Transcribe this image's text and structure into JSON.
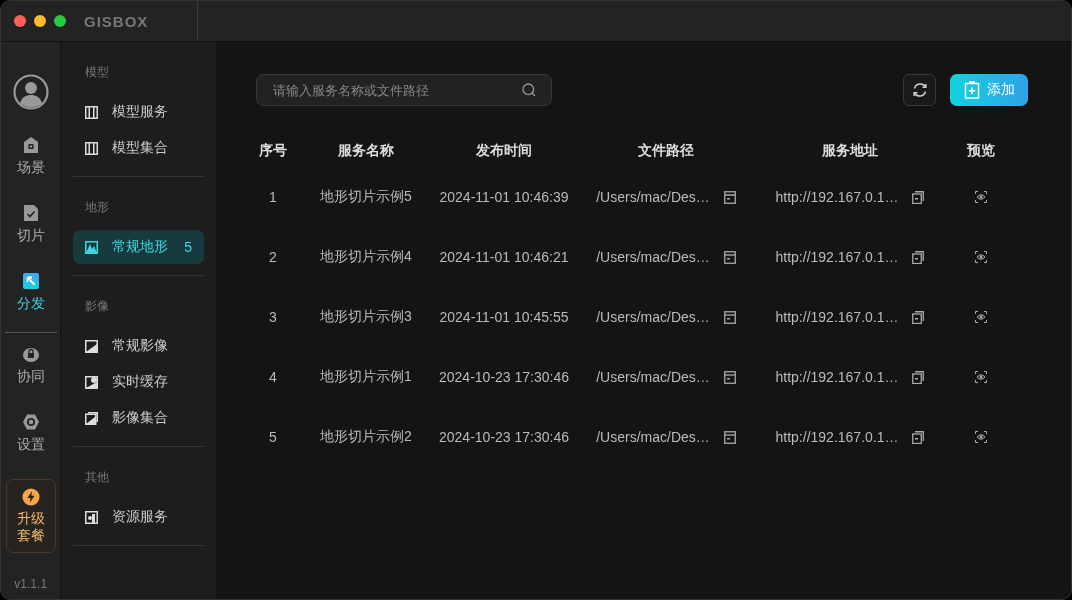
{
  "window": {
    "logo": "GISBOX"
  },
  "rail": {
    "items": [
      {
        "kind": "scene",
        "label": "场景",
        "selected": false
      },
      {
        "kind": "tile",
        "label": "切片",
        "selected": false
      },
      {
        "kind": "publish",
        "label": "分发",
        "selected": true
      },
      {
        "kind": "collab",
        "label": "协同",
        "selected": false
      },
      {
        "kind": "settings",
        "label": "设置",
        "selected": false
      }
    ],
    "upgrade": {
      "label": "升级套餐"
    },
    "version": "v1.1.1"
  },
  "sidebar": {
    "groups": [
      {
        "title": "模型",
        "items": [
          {
            "kind": "model",
            "label": "模型服务",
            "selected": false
          },
          {
            "kind": "model",
            "label": "模型集合",
            "selected": false
          }
        ]
      },
      {
        "title": "地形",
        "items": [
          {
            "kind": "terrain",
            "label": "常规地形",
            "count": "5",
            "selected": true
          }
        ]
      },
      {
        "title": "影像",
        "items": [
          {
            "kind": "image",
            "label": "常规影像",
            "selected": false
          },
          {
            "kind": "cache",
            "label": "实时缓存",
            "selected": false
          },
          {
            "kind": "collection",
            "label": "影像集合",
            "selected": false
          }
        ]
      },
      {
        "title": "其他",
        "items": [
          {
            "kind": "resource",
            "label": "资源服务",
            "selected": false
          }
        ]
      }
    ]
  },
  "search": {
    "placeholder": "请输入服务名称或文件路径"
  },
  "add_button": {
    "label": "添加"
  },
  "table": {
    "columns": [
      "序号",
      "服务名称",
      "发布时间",
      "文件路径",
      "服务地址",
      "预览"
    ],
    "rows": [
      {
        "index": "1",
        "name": "地形切片示例5",
        "time": "2024-11-01 10:46:39",
        "path": "/Users/mac/Des…",
        "address": "http://192.167.0.1…"
      },
      {
        "index": "2",
        "name": "地形切片示例4",
        "time": "2024-11-01 10:46:21",
        "path": "/Users/mac/Des…",
        "address": "http://192.167.0.1…"
      },
      {
        "index": "3",
        "name": "地形切片示例3",
        "time": "2024-11-01 10:45:55",
        "path": "/Users/mac/Des…",
        "address": "http://192.167.0.1…"
      },
      {
        "index": "4",
        "name": "地形切片示例1",
        "time": "2024-10-23 17:30:46",
        "path": "/Users/mac/Des…",
        "address": "http://192.167.0.1…"
      },
      {
        "index": "5",
        "name": "地形切片示例2",
        "time": "2024-10-23 17:30:46",
        "path": "/Users/mac/Des…",
        "address": "http://192.167.0.1…"
      }
    ]
  }
}
